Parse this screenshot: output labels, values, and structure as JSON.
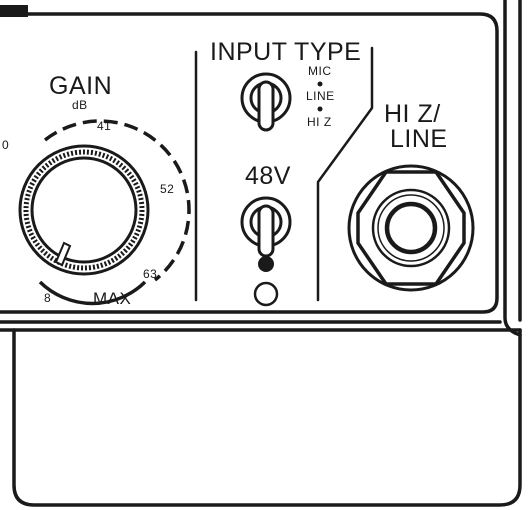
{
  "gain": {
    "title": "GAIN",
    "unit": "dB",
    "scale": [
      "0",
      "41",
      "52",
      "8",
      "63",
      "MAX"
    ],
    "knob_icon": "rotary-gain-knob"
  },
  "input_type": {
    "title": "INPUT TYPE",
    "options": [
      "MIC",
      "LINE",
      "HI Z"
    ],
    "switch_icon": "toggle-switch"
  },
  "phantom": {
    "label": "48V",
    "switch_icon": "toggle-switch",
    "led_icon": "led-indicator"
  },
  "hiz_line": {
    "label_line1": "HI Z/",
    "label_line2": "LINE",
    "jack_icon": "quarter-inch-jack"
  },
  "colors": {
    "ink": "#1a1a1a",
    "background": "#ffffff"
  }
}
